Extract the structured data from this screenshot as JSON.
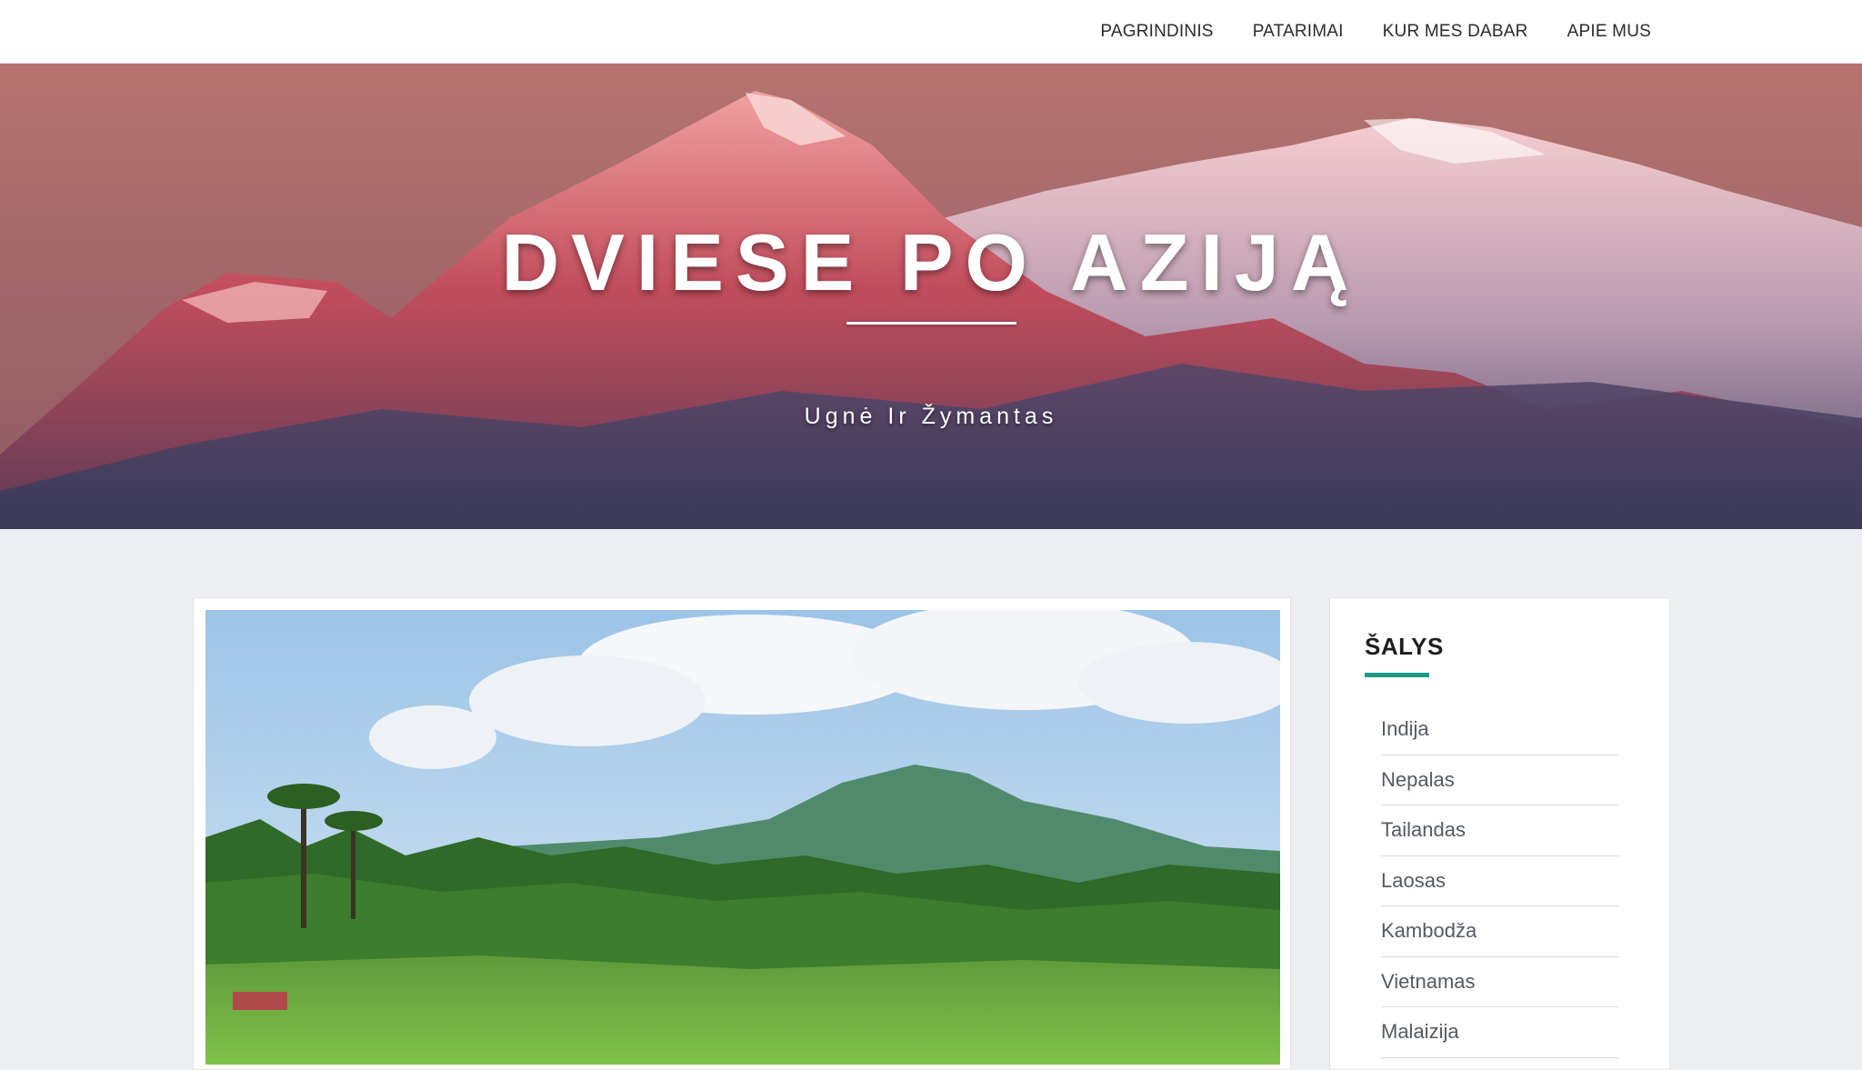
{
  "nav": {
    "items": [
      {
        "label": "PAGRINDINIS"
      },
      {
        "label": "PATARIMAI"
      },
      {
        "label": "KUR MES DABAR"
      },
      {
        "label": "APIE MUS"
      }
    ]
  },
  "hero": {
    "title": "DVIESE PO AZIJĄ",
    "subtitle": "Ugnė Ir Žymantas"
  },
  "sidebar": {
    "widget_title": "ŠALYS",
    "accent_color": "#1a9b87",
    "countries": [
      {
        "label": "Indija"
      },
      {
        "label": "Nepalas"
      },
      {
        "label": "Tailandas"
      },
      {
        "label": "Laosas"
      },
      {
        "label": "Kambodža"
      },
      {
        "label": "Vietnamas"
      },
      {
        "label": "Malaizija"
      }
    ]
  }
}
